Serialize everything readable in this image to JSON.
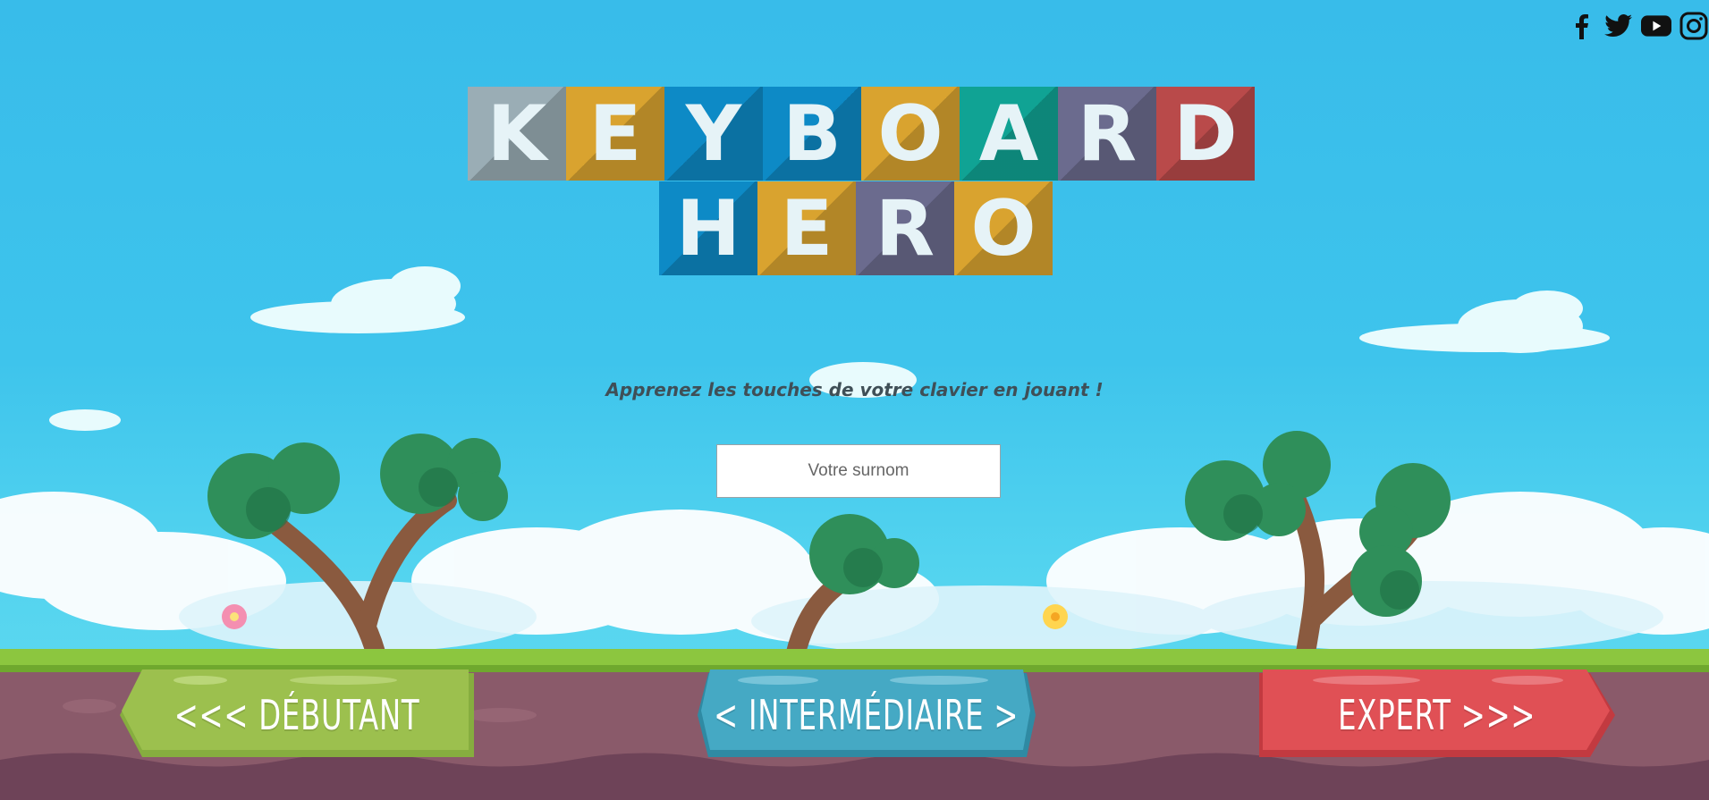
{
  "social": {
    "items": [
      {
        "name": "facebook-icon",
        "glyph": "f"
      },
      {
        "name": "twitter-icon"
      },
      {
        "name": "youtube-icon"
      },
      {
        "name": "instagram-icon"
      }
    ]
  },
  "logo": {
    "row1": [
      "K",
      "E",
      "Y",
      "B",
      "O",
      "A",
      "R",
      "D"
    ],
    "row2": [
      "H",
      "E",
      "R",
      "O"
    ],
    "colors_row1": [
      "#9aadb5",
      "#d9a32f",
      "#0d8ac6",
      "#0d8ac6",
      "#d9a32f",
      "#10a394",
      "#6b6b8e",
      "#b94a4a"
    ],
    "colors_row2": [
      "#0d8ac6",
      "#d9a32f",
      "#6b6b8e",
      "#d9a32f"
    ]
  },
  "tagline": "Apprenez les touches de votre clavier en jouant !",
  "nickname": {
    "placeholder": "Votre surnom",
    "value": ""
  },
  "levels": [
    {
      "label": "<<< DÉBUTANT",
      "color": "#9cc04e"
    },
    {
      "label": "< INTERMÉDIAIRE >",
      "color": "#45a9c4"
    },
    {
      "label": "EXPERT >>>",
      "color": "#e05055"
    }
  ],
  "colors": {
    "sky": "#38bcea",
    "grass": "#8cc63f",
    "soil": "#8a5a6a"
  }
}
